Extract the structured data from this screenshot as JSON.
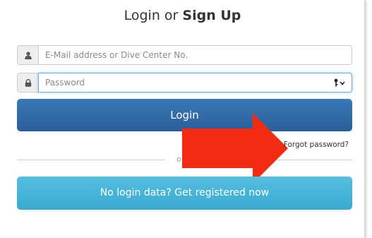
{
  "header": {
    "title_prefix": "Login or ",
    "title_strong": "Sign Up"
  },
  "form": {
    "email_placeholder": "E-Mail address or Dive Center No.",
    "email_value": "",
    "password_placeholder": "Password",
    "password_value": "",
    "login_label": "Login",
    "forgot_label": "Forgot password?",
    "or_label": "o",
    "register_label": "No login data? Get registered now"
  },
  "icons": {
    "email_addon": "user-icon",
    "password_addon": "lock-icon",
    "password_toggle": "key-icon"
  },
  "colors": {
    "login_button": "#2d66a3",
    "register_button": "#46b4d9",
    "arrow": "#f22b13"
  }
}
